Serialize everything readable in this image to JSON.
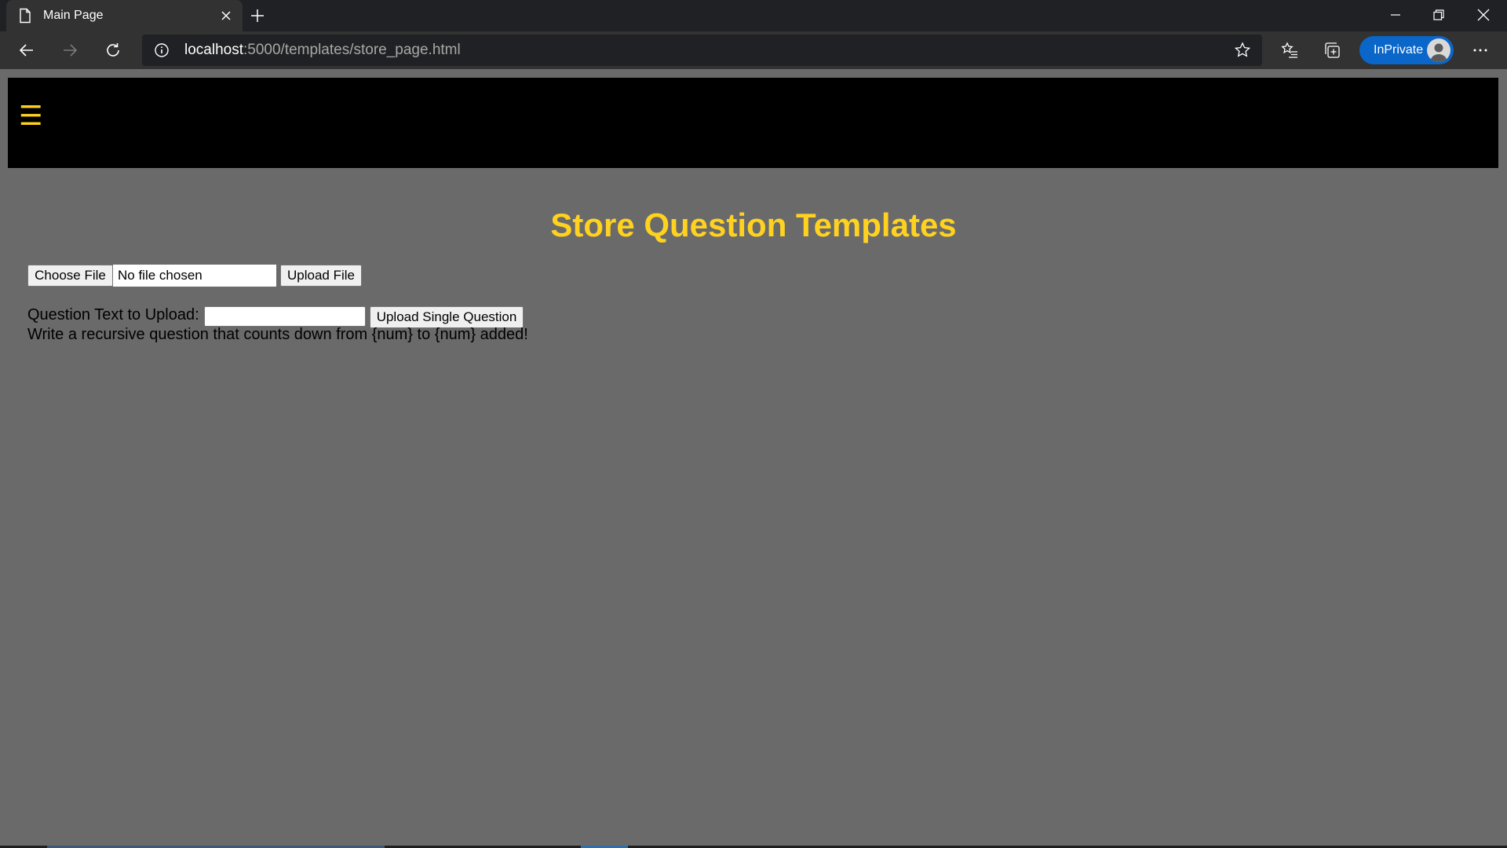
{
  "browser": {
    "tab": {
      "title": "Main Page",
      "icon": "page-icon"
    },
    "address": {
      "host": "localhost",
      "path": ":5000/templates/store_page.html"
    },
    "profile_label": "InPrivate",
    "accent_color": "#0a66c8"
  },
  "page": {
    "header": {
      "menu_icon": "☰",
      "menu_color": "#ffd21f"
    },
    "title": "Store Question Templates",
    "file_upload": {
      "choose_label": "Choose File",
      "file_status": "No file chosen",
      "upload_label": "Upload File"
    },
    "single_question": {
      "label": "Question Text to Upload:",
      "value": "",
      "button_label": "Upload Single Question"
    },
    "status_message": "Write a recursive question that counts down from {num} to {num} added!"
  }
}
